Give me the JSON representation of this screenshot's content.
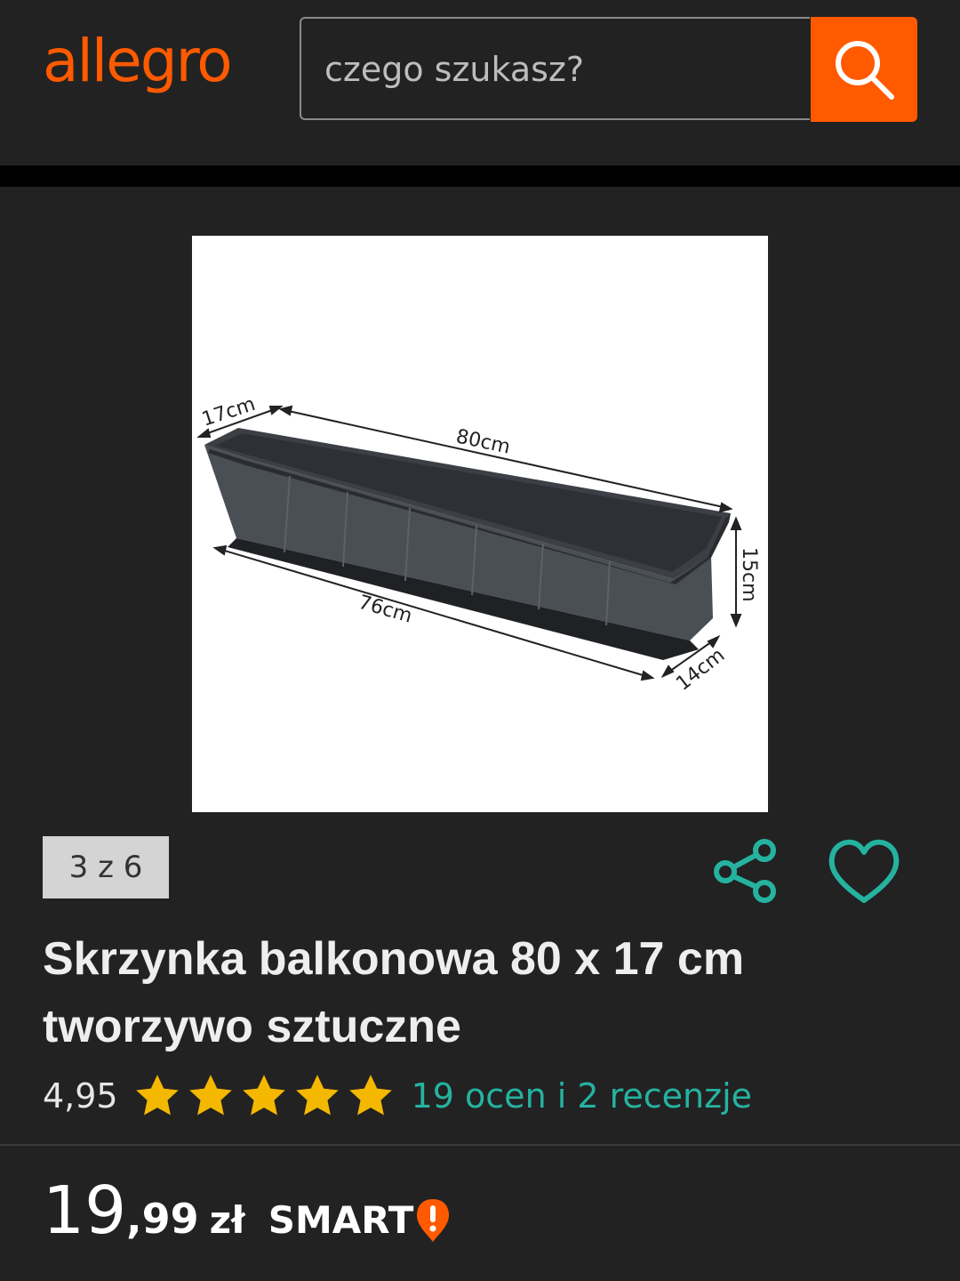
{
  "header": {
    "logo": "allegro",
    "search": {
      "placeholder": "czego szukasz?",
      "value": ""
    },
    "search_button_icon": "search-icon",
    "accent_color": "#ff5a00"
  },
  "gallery": {
    "counter": "3 z 6",
    "image_labels": {
      "length_top": "80cm",
      "width_top": "17cm",
      "height": "15cm",
      "length_bottom": "76cm",
      "width_bottom": "14cm"
    }
  },
  "actions": {
    "share_icon": "share-icon",
    "favorite_icon": "heart-icon",
    "icon_color": "#25b3a0"
  },
  "product": {
    "title_line1": "Skrzynka balkonowa 80 x 17 cm",
    "title_line2": "tworzywo sztuczne",
    "rating": "4,95",
    "stars": 5,
    "star_color": "#f5b800",
    "reviews_link": "19 ocen i 2 recenzje"
  },
  "price": {
    "integer": "19",
    "decimal": ",99",
    "currency": "zł",
    "badge": "SMART"
  }
}
